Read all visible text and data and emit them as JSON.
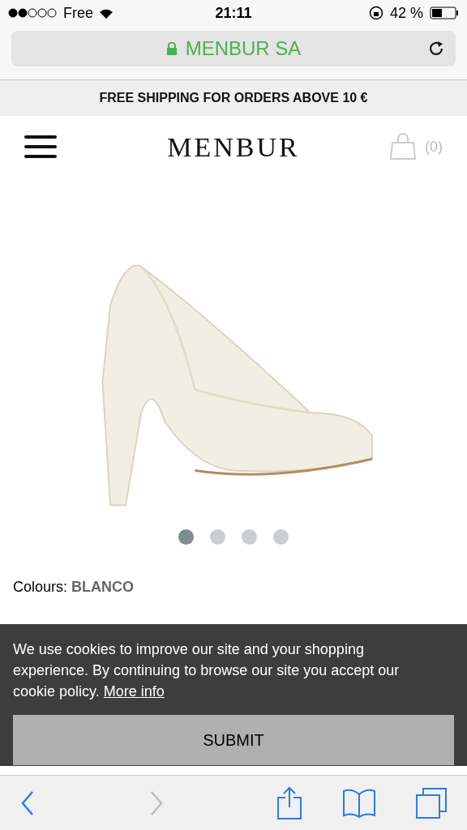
{
  "status_bar": {
    "carrier": "Free",
    "time": "21:11",
    "battery": "42 %"
  },
  "address_bar": {
    "site": "MENBUR SA",
    "secure": true
  },
  "promo_banner": "FREE SHIPPING FOR ORDERS ABOVE 10 €",
  "header": {
    "logo": "MENBUR",
    "cart_count": "(0)"
  },
  "carousel": {
    "dots": [
      {
        "selected": true
      },
      {
        "selected": false
      },
      {
        "selected": false
      },
      {
        "selected": false
      }
    ]
  },
  "colours": {
    "label": "Colours:",
    "value": "BLANCO"
  },
  "cookie_banner": {
    "text": "We use cookies to improve our site and your shopping experience. By continuing to browse our site you accept our cookie policy.",
    "link": "More info",
    "button": "SUBMIT"
  },
  "toolbar": {
    "back_disabled": false,
    "forward_disabled": true
  }
}
